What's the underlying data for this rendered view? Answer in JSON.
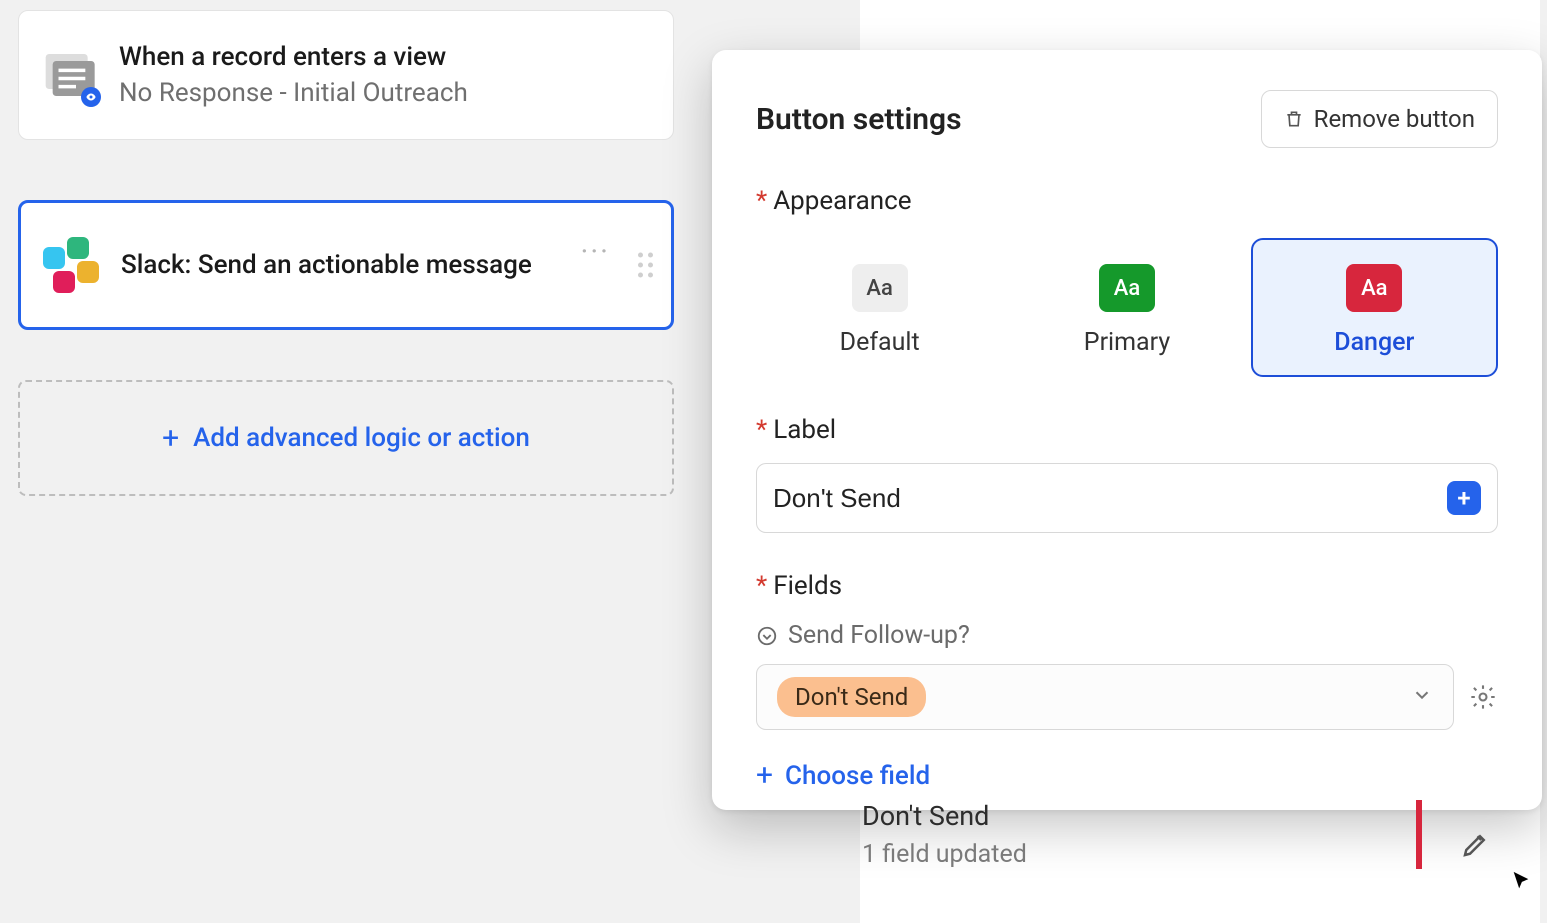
{
  "trigger": {
    "title": "When a record enters a view",
    "subtitle": "No Response - Initial Outreach"
  },
  "action": {
    "title": "Slack: Send an actionable message"
  },
  "add_action_label": "Add advanced logic or action",
  "modal": {
    "title": "Button settings",
    "remove_label": "Remove button",
    "appearance_label": "Appearance",
    "appearance_options": {
      "default": "Default",
      "primary": "Primary",
      "danger": "Danger"
    },
    "appearance_selected": "danger",
    "swatch_text": "Aa",
    "label_section": "Label",
    "label_value": "Don't Send",
    "fields_section": "Fields",
    "field_name": "Send Follow-up?",
    "field_value": "Don't Send",
    "choose_field_label": "Choose field"
  },
  "peek": {
    "title": "Don't Send",
    "subtitle": "1 field updated"
  },
  "colors": {
    "accent": "#2563eb",
    "danger": "#d7263d",
    "primary": "#15992b"
  }
}
